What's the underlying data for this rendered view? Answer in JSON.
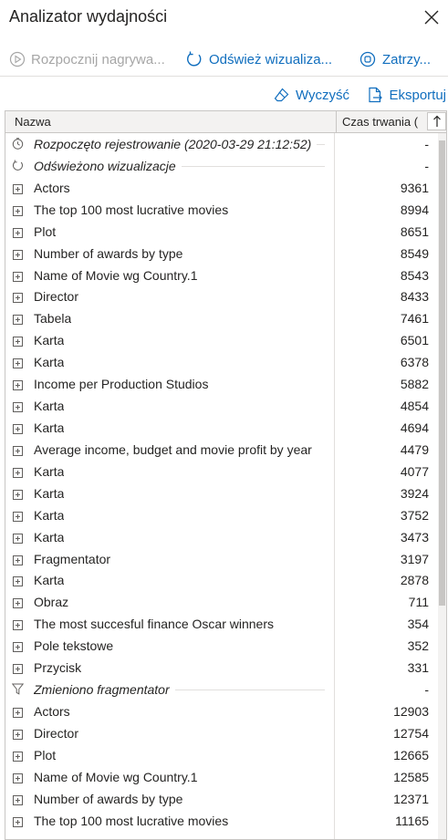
{
  "pane": {
    "title": "Analizator wydajności"
  },
  "toolbar": {
    "start_recording": "Rozpocznij nagrywa...",
    "refresh_visuals": "Odśwież wizualiza...",
    "stop": "Zatrzy...",
    "clear": "Wyczyść",
    "export": "Eksportuj"
  },
  "table": {
    "headers": {
      "name": "Nazwa",
      "duration": "Czas trwania ("
    },
    "rows": [
      {
        "kind": "event",
        "icon": "timer-icon",
        "name": "Rozpoczęto rejestrowanie (2020-03-29 21:12:52)",
        "duration": "-"
      },
      {
        "kind": "event",
        "icon": "refresh-icon",
        "name": "Odświeżono wizualizacje",
        "duration": "-"
      },
      {
        "kind": "visual",
        "name": "Actors",
        "duration": "9361"
      },
      {
        "kind": "visual",
        "name": "The top 100 most lucrative movies",
        "duration": "8994"
      },
      {
        "kind": "visual",
        "name": "Plot",
        "duration": "8651"
      },
      {
        "kind": "visual",
        "name": "Number of awards by type",
        "duration": "8549"
      },
      {
        "kind": "visual",
        "name": "Name of Movie wg Country.1",
        "duration": "8543"
      },
      {
        "kind": "visual",
        "name": "Director",
        "duration": "8433"
      },
      {
        "kind": "visual",
        "name": "Tabela",
        "duration": "7461"
      },
      {
        "kind": "visual",
        "name": "Karta",
        "duration": "6501"
      },
      {
        "kind": "visual",
        "name": "Karta",
        "duration": "6378"
      },
      {
        "kind": "visual",
        "name": "Income per Production Studios",
        "duration": "5882"
      },
      {
        "kind": "visual",
        "name": "Karta",
        "duration": "4854"
      },
      {
        "kind": "visual",
        "name": "Karta",
        "duration": "4694"
      },
      {
        "kind": "visual",
        "name": "Average income, budget and movie profit by year",
        "duration": "4479"
      },
      {
        "kind": "visual",
        "name": "Karta",
        "duration": "4077"
      },
      {
        "kind": "visual",
        "name": "Karta",
        "duration": "3924"
      },
      {
        "kind": "visual",
        "name": "Karta",
        "duration": "3752"
      },
      {
        "kind": "visual",
        "name": "Karta",
        "duration": "3473"
      },
      {
        "kind": "visual",
        "name": "Fragmentator",
        "duration": "3197"
      },
      {
        "kind": "visual",
        "name": "Karta",
        "duration": "2878"
      },
      {
        "kind": "visual",
        "name": "Obraz",
        "duration": "711"
      },
      {
        "kind": "visual",
        "name": "The most succesful finance Oscar winners",
        "duration": "354"
      },
      {
        "kind": "visual",
        "name": "Pole tekstowe",
        "duration": "352"
      },
      {
        "kind": "visual",
        "name": "Przycisk",
        "duration": "331"
      },
      {
        "kind": "event",
        "icon": "filter-icon",
        "name": "Zmieniono fragmentator",
        "duration": "-"
      },
      {
        "kind": "visual",
        "name": "Actors",
        "duration": "12903"
      },
      {
        "kind": "visual",
        "name": "Director",
        "duration": "12754"
      },
      {
        "kind": "visual",
        "name": "Plot",
        "duration": "12665"
      },
      {
        "kind": "visual",
        "name": "Name of Movie wg Country.1",
        "duration": "12585"
      },
      {
        "kind": "visual",
        "name": "Number of awards by type",
        "duration": "12371"
      },
      {
        "kind": "visual",
        "name": "The top 100 most lucrative movies",
        "duration": "11165"
      }
    ]
  }
}
